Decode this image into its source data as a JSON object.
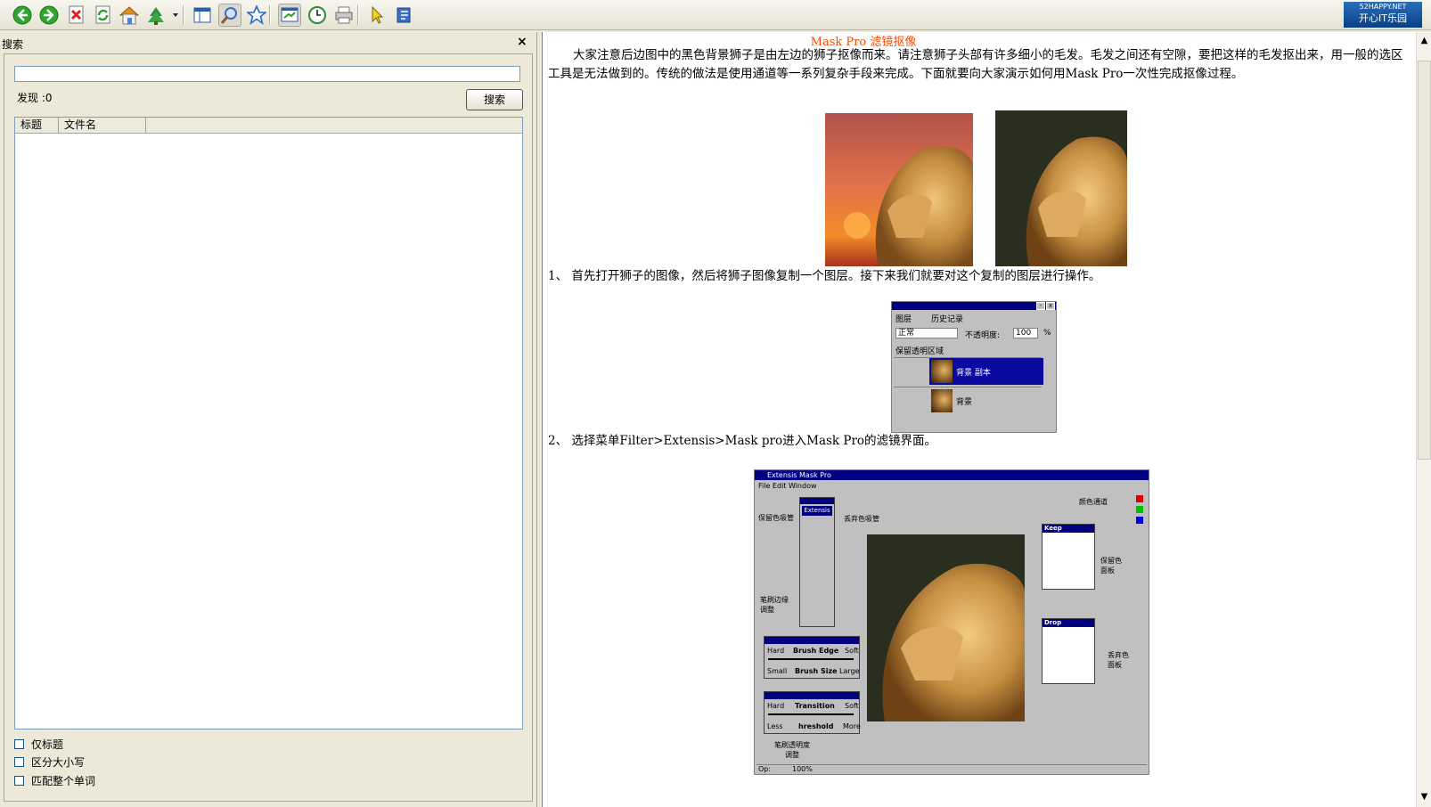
{
  "toolbar": {
    "buttons": [
      "back-icon",
      "forward-icon",
      "stop-icon",
      "refresh-icon",
      "home-icon",
      "sync-tree-icon",
      "show-tabs-icon",
      "search-icon",
      "favorites-icon",
      "jump-icon",
      "history-icon",
      "print-icon",
      "pointer-icon",
      "options-icon"
    ],
    "brand_line1": "52HAPPY.NET",
    "brand_line2": "开心IT乐园"
  },
  "search_pane": {
    "title": "搜索",
    "close": "×",
    "query": "",
    "found_label": "发现 :0",
    "search_button": "搜索",
    "columns": [
      "标题",
      "文件名"
    ],
    "options": [
      "仅标题",
      "区分大小写",
      "匹配整个单词"
    ]
  },
  "article": {
    "title": "Mask Pro 滤镜抠像",
    "intro": "大家注意后边图中的黑色背景狮子是由左边的狮子抠像而来。请注意狮子头部有许多细小的毛发。毛发之间还有空隙，要把这样的毛发抠出来，用一般的选区工具是无法做到的。传统的做法是使用通道等一系列复杂手段来完成。下面就要向大家演示如何用Mask Pro一次性完成抠像过程。",
    "step1": "1、 首先打开狮子的图像，然后将狮子图像复制一个图层。接下来我们就要对这个复制的图层进行操作。",
    "step2": "2、 选择菜单Filter>Extensis>Mask pro进入Mask Pro的滤镜界面。"
  },
  "layers_panel": {
    "tab1": "图层",
    "tab2": "历史记录",
    "mode": "正常",
    "opacity_label": "不透明度:",
    "opacity_value": "100",
    "percent": "%",
    "preserve": "保留透明区域",
    "layer_copy": "背景 副本",
    "layer_bg": "背景"
  },
  "maskpro": {
    "window_title": "Extensis Mask Pro",
    "menu": "File  Edit  Window",
    "brand": "Extensis",
    "keep_dropper": "保留色吸管",
    "drop_dropper": "丢弃色吸管",
    "color_channel": "颜色通道",
    "brush_edge_adjust": "笔刷边缘\n调整",
    "brush_alpha_adjust": "笔刷透明度\n调整",
    "keep_panel": "保留色\n面板",
    "drop_panel": "丢弃色\n面板",
    "keep": "Keep",
    "drop": "Drop",
    "hard": "Hard",
    "soft": "Soft",
    "brush_edge": "Brush Edge",
    "small": "Small",
    "large": "Large",
    "brush_size": "Brush Size",
    "transition": "Transition",
    "less": "Less",
    "more": "More",
    "threshold": "hreshold",
    "op": "Op:",
    "zoom": "100%"
  },
  "colors": {
    "title_orange": "#ff4a00",
    "win_blue": "#000080",
    "layer_select": "#0a0a9e"
  }
}
